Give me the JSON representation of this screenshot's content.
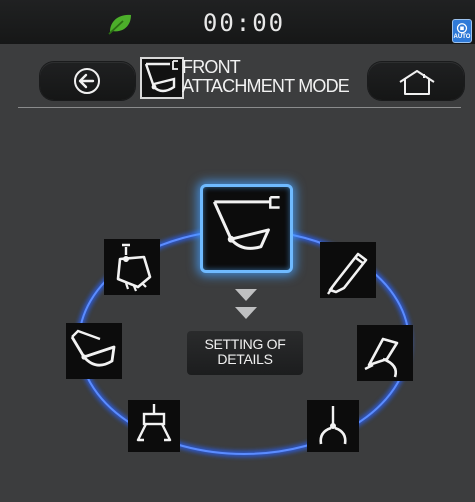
{
  "status": {
    "clock": "00:00",
    "eco_icon": "leaf-icon",
    "auto_badge": "AUTO",
    "colors": {
      "eco": "#4caf2a",
      "accent": "#2f7ad8"
    }
  },
  "header": {
    "back_icon": "arrow-left-icon",
    "title_line1": "FRONT",
    "title_line2": "ATTACHMENT MODE",
    "home_icon": "home-icon"
  },
  "attachments": [
    {
      "name": "bucket-with-hook",
      "icon": "bucket-hook-icon",
      "selected": true
    },
    {
      "name": "crusher",
      "icon": "crusher-icon",
      "selected": false
    },
    {
      "name": "breaker",
      "icon": "breaker-icon",
      "selected": false
    },
    {
      "name": "grapple",
      "icon": "grapple-icon",
      "selected": false
    },
    {
      "name": "bucket",
      "icon": "bucket-icon",
      "selected": false
    },
    {
      "name": "fork-clamp",
      "icon": "fork-clamp-icon",
      "selected": false
    },
    {
      "name": "clamshell",
      "icon": "clamshell-icon",
      "selected": false
    }
  ],
  "settings": {
    "line1": "SETTING OF",
    "line2": "DETAILS"
  }
}
